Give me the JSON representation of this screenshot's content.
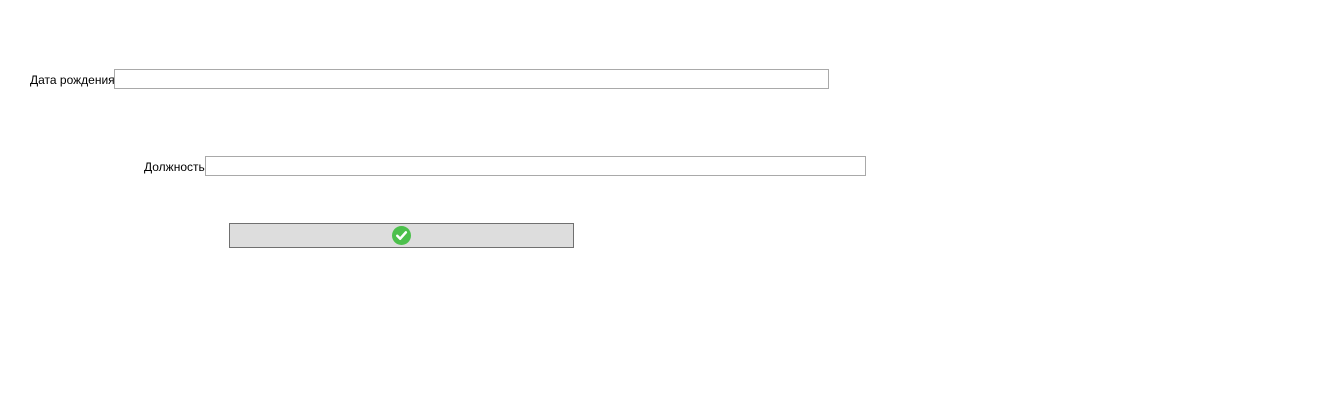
{
  "form": {
    "birth_date": {
      "label": "Дата рождения",
      "value": ""
    },
    "position": {
      "label": "Должность",
      "value": ""
    },
    "confirm_button": {
      "icon": "check-icon",
      "color": "#4cc04c"
    }
  }
}
